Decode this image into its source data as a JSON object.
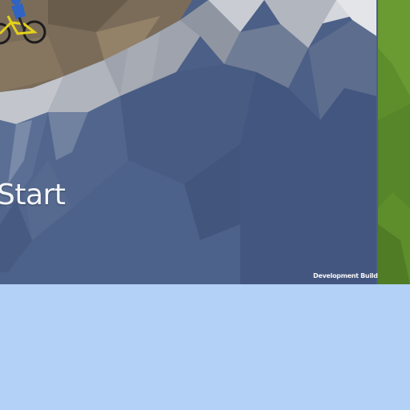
{
  "menu": {
    "start_label": "Start"
  },
  "build": {
    "label": "Development Build"
  },
  "colors": {
    "sky_blue_pane": "#b3d1f6",
    "mountain_blue": "#4a5e86",
    "snow_grey": "#b8bcc4",
    "dirt_path": "#7a6a55",
    "grass_green": "#5f8f2c",
    "bike_yellow": "#e6d21a"
  }
}
